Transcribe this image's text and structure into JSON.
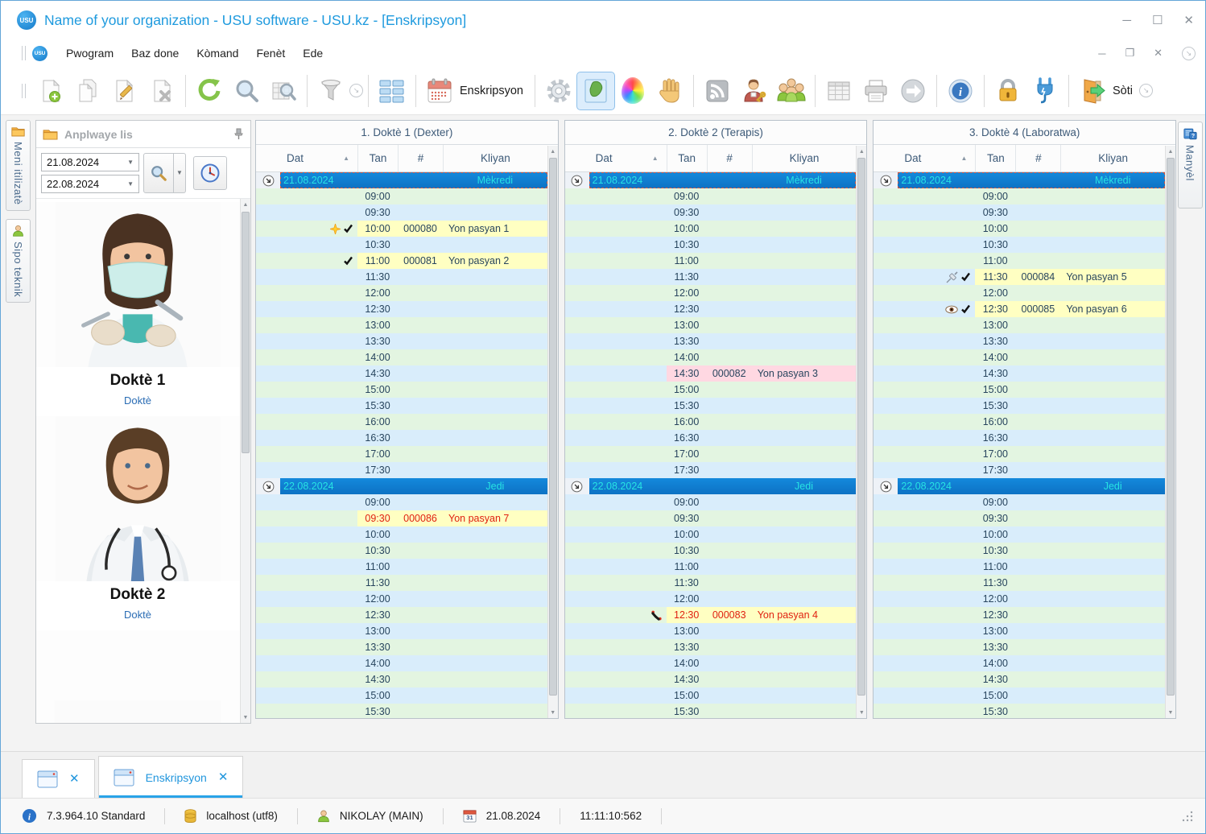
{
  "window": {
    "title": "Name of your organization - USU software - USU.kz - [Enskripsyon]",
    "logo": "USU"
  },
  "menu": {
    "items": [
      "Pwogram",
      "Baz done",
      "Kòmand",
      "Fenèt",
      "Ede"
    ]
  },
  "toolbar": {
    "calendar_label": "Enskripsyon",
    "exit_label": "Sòti",
    "icons": [
      "new-document",
      "copy-document",
      "edit-document",
      "delete-document",
      "refresh",
      "search",
      "search-table",
      "filter",
      "more-dropdown",
      "view-grid",
      "calendar",
      "settings",
      "map",
      "colors",
      "hand",
      "feed",
      "user-key",
      "users",
      "table",
      "print",
      "forward",
      "info",
      "lock",
      "plug",
      "exit"
    ]
  },
  "sidebar": {
    "tabs": [
      "Meni itilizatè",
      "Sipo teknik"
    ],
    "panel_title": "Anplwaye lis",
    "date_from": "21.08.2024",
    "date_to": "22.08.2024",
    "employees": [
      {
        "name": "Doktè 1",
        "role": "Doktè",
        "photo": "female-dentist"
      },
      {
        "name": "Doktè 2",
        "role": "Doktè",
        "photo": "male-doctor"
      },
      {
        "name": "",
        "role": "",
        "photo": "female-partial"
      }
    ]
  },
  "schedule": {
    "headers": {
      "dat": "Dat",
      "tan": "Tan",
      "num": "#",
      "kliyan": "Kliyan"
    },
    "days": [
      {
        "date": "21.08.2024",
        "weekday": "Mèkredi",
        "times": [
          "09:00",
          "09:30",
          "10:00",
          "10:30",
          "11:00",
          "11:30",
          "12:00",
          "12:30",
          "13:00",
          "13:30",
          "14:00",
          "14:30",
          "15:00",
          "15:30",
          "16:00",
          "16:30",
          "17:00",
          "17:30"
        ]
      },
      {
        "date": "22.08.2024",
        "weekday": "Jedi",
        "times": [
          "09:00",
          "09:30",
          "10:00",
          "10:30",
          "11:00",
          "11:30",
          "12:00",
          "12:30",
          "13:00",
          "13:30",
          "14:00",
          "14:30",
          "15:00",
          "15:30"
        ]
      }
    ],
    "columns": [
      {
        "title": "1. Doktè 1 (Dexter)",
        "appointments": [
          {
            "day": 0,
            "time": "10:00",
            "num": "000080",
            "client": "Yon pasyan 1",
            "icons": [
              "star",
              "check"
            ],
            "style": "yellow",
            "red": false
          },
          {
            "day": 0,
            "time": "11:00",
            "num": "000081",
            "client": "Yon pasyan 2",
            "icons": [
              "check"
            ],
            "style": "yellow",
            "red": false
          },
          {
            "day": 1,
            "time": "09:30",
            "num": "000086",
            "client": "Yon pasyan 7",
            "icons": [],
            "style": "yellow",
            "red": true
          }
        ]
      },
      {
        "title": "2. Doktè 2 (Terapis)",
        "appointments": [
          {
            "day": 0,
            "time": "14:30",
            "num": "000082",
            "client": "Yon pasyan 3",
            "icons": [],
            "style": "pink",
            "red": false
          },
          {
            "day": 1,
            "time": "12:30",
            "num": "000083",
            "client": "Yon pasyan 4",
            "icons": [
              "phone"
            ],
            "style": "yellow",
            "red": true
          }
        ]
      },
      {
        "title": "3. Doktè 4 (Laboratwa)",
        "appointments": [
          {
            "day": 0,
            "time": "11:30",
            "num": "000084",
            "client": "Yon pasyan 5",
            "icons": [
              "syringe",
              "check"
            ],
            "style": "yellow",
            "red": false
          },
          {
            "day": 0,
            "time": "12:30",
            "num": "000085",
            "client": "Yon pasyan 6",
            "icons": [
              "eye",
              "check"
            ],
            "style": "yellow",
            "red": false
          }
        ]
      }
    ]
  },
  "right_tab": {
    "label": "Manyèl"
  },
  "bottom_tabs": [
    {
      "label": ""
    },
    {
      "label": "Enskripsyon",
      "active": true
    }
  ],
  "status": {
    "version": "7.3.964.10 Standard",
    "database": "localhost (utf8)",
    "user": "NIKOLAY (MAIN)",
    "date": "21.08.2024",
    "time": "11:11:10:562",
    "calendar_day": "31"
  },
  "colors": {
    "accent": "#1e9ade",
    "row_green": "#e3f5e1",
    "row_blue": "#d9edfb",
    "appt_yellow": "#ffffc2",
    "appt_pink": "#ffd8e2",
    "date_header_blue": "#0f7cd0",
    "date_header_text": "#27e3e3",
    "appointment_red": "#e02010",
    "row_text": "#28455e"
  }
}
